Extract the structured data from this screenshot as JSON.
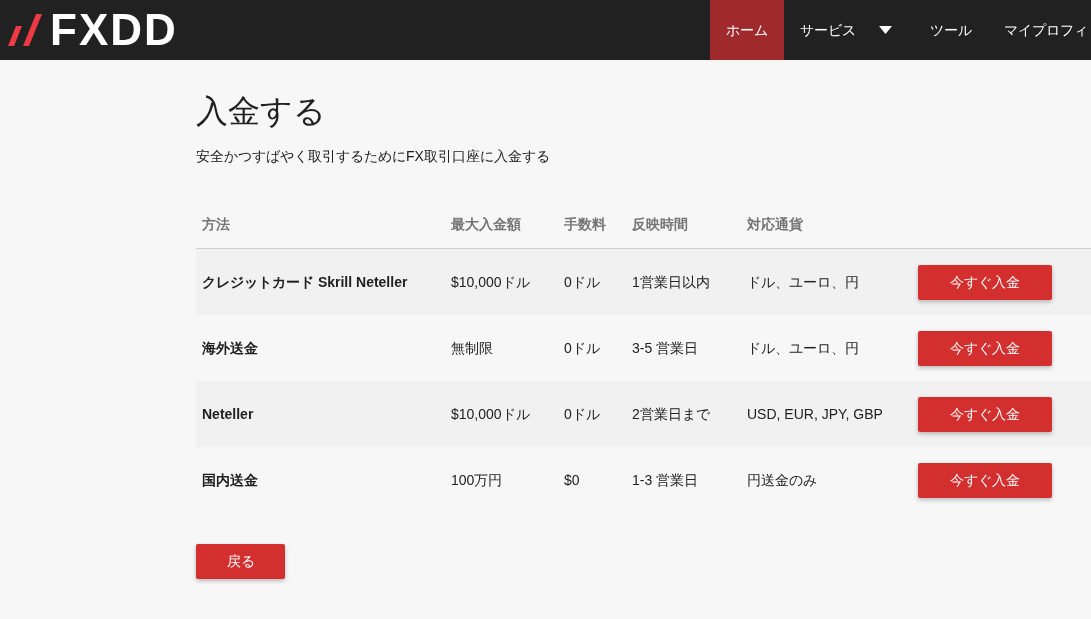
{
  "header": {
    "logo": "FXDD",
    "nav": [
      {
        "label": "ホーム",
        "selected": true,
        "dropdown": false
      },
      {
        "label": "サービス",
        "selected": false,
        "dropdown": true
      },
      {
        "label": "ツール",
        "selected": false,
        "dropdown": false
      },
      {
        "label": "マイプロフィ",
        "selected": false,
        "dropdown": false
      }
    ]
  },
  "page": {
    "title": "入金する",
    "subtitle": "安全かつすばやく取引するためにFX取引口座に入金する"
  },
  "table": {
    "columns": [
      "方法",
      "最大入金額",
      "手数料",
      "反映時間",
      "対応通貨"
    ],
    "rows": [
      {
        "cells": [
          "クレジットカード Skrill Neteller",
          "$10,000ドル",
          "0ドル",
          "1営業日以内",
          "ドル、ユーロ、円"
        ],
        "button": "今すぐ入金"
      },
      {
        "cells": [
          "海外送金",
          "無制限",
          "0ドル",
          "3-5 営業日",
          "ドル、ユーロ、円"
        ],
        "button": "今すぐ入金"
      },
      {
        "cells": [
          "Neteller",
          "$10,000ドル",
          "0ドル",
          "2営業日まで",
          "USD, EUR, JPY, GBP"
        ],
        "button": "今すぐ入金"
      },
      {
        "cells": [
          "国内送金",
          "100万円",
          "$0",
          "1-3 営業日",
          "円送金のみ"
        ],
        "button": "今すぐ入金"
      }
    ]
  },
  "back_button": "戻る"
}
